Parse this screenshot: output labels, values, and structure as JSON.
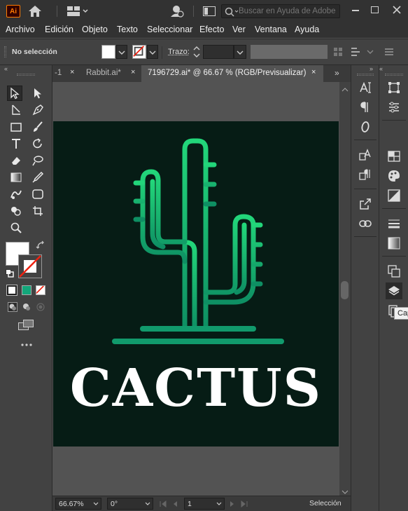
{
  "app": {
    "logo": "Ai"
  },
  "search": {
    "placeholder": "Buscar en Ayuda de Adobe"
  },
  "menu": [
    "Archivo",
    "Edición",
    "Objeto",
    "Texto",
    "Seleccionar",
    "Efecto",
    "Ver",
    "Ventana",
    "Ayuda"
  ],
  "control": {
    "selection_label": "No selección",
    "stroke_label": "Trazo:"
  },
  "tabs": [
    {
      "label": "-1",
      "active": false
    },
    {
      "label": "Rabbit.ai*",
      "active": false
    },
    {
      "label": "7196729.ai* @ 66.67 % (RGB/Previsualizar)",
      "active": true
    }
  ],
  "artwork": {
    "title": "CACTUS",
    "background": "#061c15",
    "gradient_top": "#22d67a",
    "gradient_bottom": "#0e8f63"
  },
  "status": {
    "zoom": "66.67%",
    "rotation": "0°",
    "artboard": "1",
    "tool": "Selección"
  },
  "tooltip": "Cap"
}
